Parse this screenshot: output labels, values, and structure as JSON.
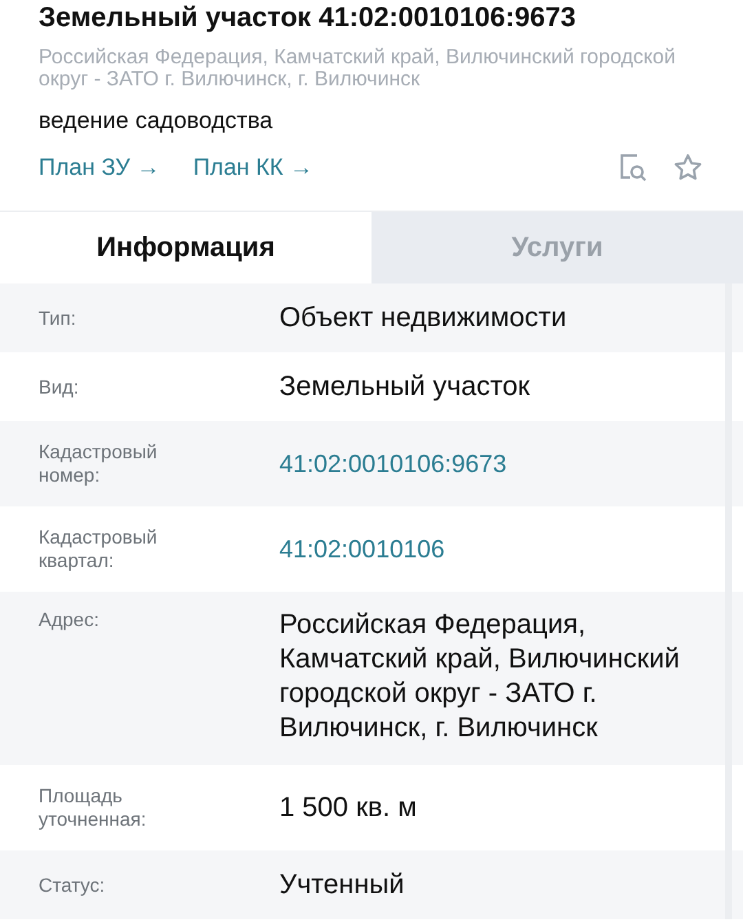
{
  "title": "Земельный участок 41:02:0010106:9673",
  "address": "Российская Федерация, Камчатский край, Вилючинский городской округ - ЗАТО г. Вилючинск, г. Вилючинск",
  "purpose": "ведение садоводства",
  "links": [
    {
      "label": "План ЗУ",
      "arrow": "→"
    },
    {
      "label": "План КК",
      "arrow": "→"
    }
  ],
  "tabs": [
    {
      "label": "Информация",
      "selected": true
    },
    {
      "label": "Услуги",
      "selected": false
    }
  ],
  "rows": [
    {
      "label": "Тип:",
      "value": "Объект недвижимости",
      "kind": "text"
    },
    {
      "label": "Вид:",
      "value": "Земельный участок",
      "kind": "text"
    },
    {
      "label": "Кадастровый номер:",
      "value": "41:02:0010106:9673",
      "kind": "link"
    },
    {
      "label": "Кадастровый квартал:",
      "value": "41:02:0010106",
      "kind": "link"
    },
    {
      "label": "Адрес:",
      "value": "Российская Федерация, Камчатский край, Вилючинский городской округ - ЗАТО г. Вилючинск, г. Вилючинск",
      "kind": "text"
    },
    {
      "label": "Площадь уточненная:",
      "value": "1 500 кв. м",
      "kind": "text"
    },
    {
      "label": "Статус:",
      "value": "Учтенный",
      "kind": "text"
    }
  ]
}
